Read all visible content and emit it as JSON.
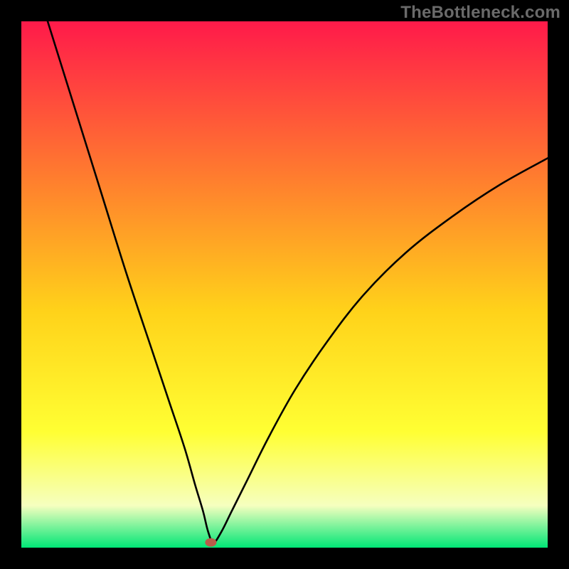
{
  "watermark": "TheBottleneck.com",
  "chart_data": {
    "type": "line",
    "title": "",
    "xlabel": "",
    "ylabel": "",
    "xlim": [
      0,
      100
    ],
    "ylim": [
      0,
      100
    ],
    "grid": false,
    "legend": false,
    "background_gradient": {
      "top": "#ff1a4a",
      "mid_upper": "#ff7e2e",
      "mid": "#ffd21a",
      "mid_lower": "#ffff33",
      "lower": "#f6ffbf",
      "bottom": "#00e676"
    },
    "curve_stroke": "#000000",
    "marker": {
      "x": 36,
      "y": 1,
      "color": "#b85c4a"
    },
    "series": [
      {
        "name": "bottleneck-curve",
        "x": [
          5,
          10,
          15,
          20,
          25,
          28,
          31,
          33,
          34.5,
          35.5,
          36.5,
          38,
          40,
          43,
          47,
          52,
          58,
          65,
          73,
          82,
          91,
          100
        ],
        "y": [
          100,
          84,
          68,
          52,
          37,
          28,
          19,
          12,
          7,
          3,
          1,
          3,
          7,
          13,
          21,
          30,
          39,
          48,
          56,
          63,
          69,
          74
        ]
      }
    ]
  }
}
